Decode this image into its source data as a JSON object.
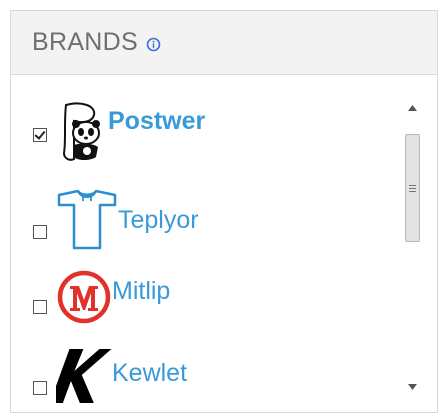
{
  "header": {
    "title": "BRANDS",
    "info_icon": "info-circle-icon"
  },
  "accent_color": "#3a9ad9",
  "brands": [
    {
      "label": "Postwer",
      "checked": true,
      "logo": "panda-icon"
    },
    {
      "label": "Teplyor",
      "checked": false,
      "logo": "tshirt-icon"
    },
    {
      "label": "Mitlip",
      "checked": false,
      "logo": "m-circle-icon"
    },
    {
      "label": "Kewlet",
      "checked": false,
      "logo": "k-letter-icon"
    }
  ]
}
